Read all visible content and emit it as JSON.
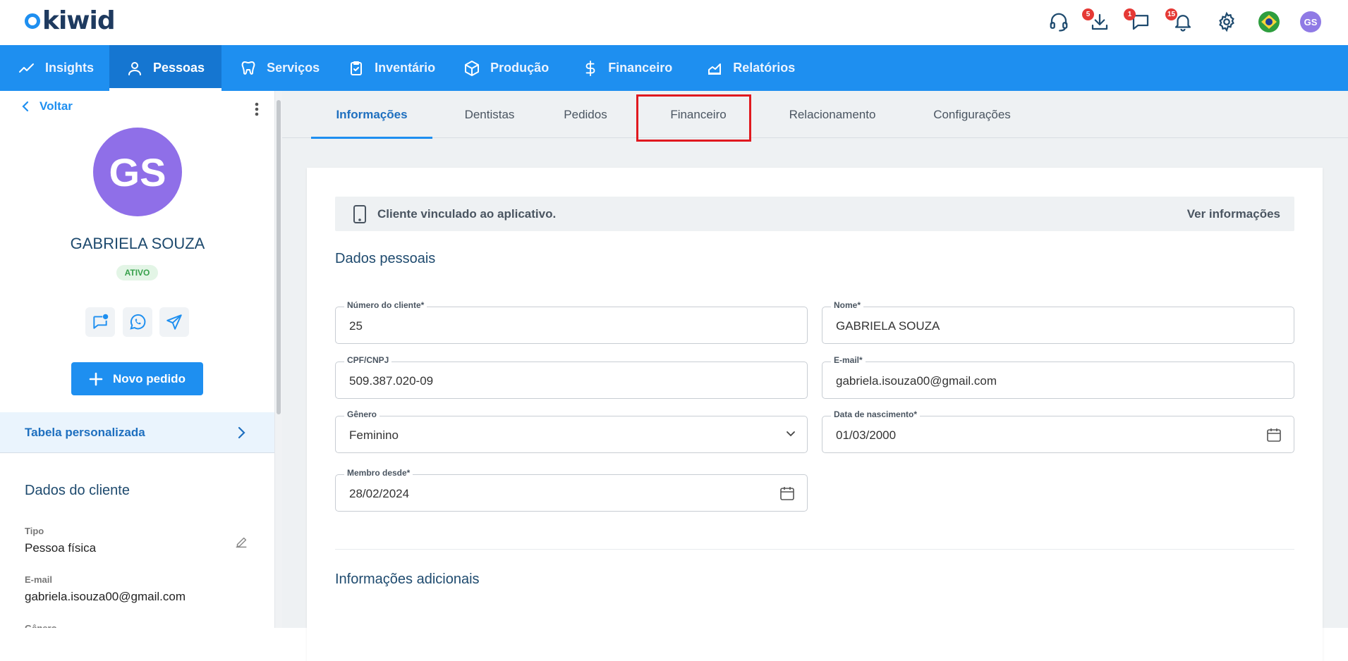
{
  "brand": {
    "name": "kiwid"
  },
  "topbar": {
    "badges": {
      "downloads": "5",
      "messages": "1",
      "notifications": "15"
    },
    "user_initials": "GS"
  },
  "nav": {
    "items": [
      {
        "label": "Insights"
      },
      {
        "label": "Pessoas"
      },
      {
        "label": "Serviços"
      },
      {
        "label": "Inventário"
      },
      {
        "label": "Produção"
      },
      {
        "label": "Financeiro"
      },
      {
        "label": "Relatórios"
      }
    ]
  },
  "left": {
    "back_label": "Voltar",
    "initials": "GS",
    "name": "GABRIELA SOUZA",
    "status": "ATIVO",
    "new_order_label": "Novo pedido",
    "table_label": "Tabela personalizada",
    "client_section_title": "Dados do cliente",
    "fields": [
      {
        "label": "Tipo",
        "value": "Pessoa física"
      },
      {
        "label": "E-mail",
        "value": "gabriela.isouza00@gmail.com"
      },
      {
        "label": "Gênero",
        "value": ""
      }
    ]
  },
  "tabs": [
    {
      "label": "Informações"
    },
    {
      "label": "Dentistas"
    },
    {
      "label": "Pedidos"
    },
    {
      "label": "Financeiro"
    },
    {
      "label": "Relacionamento"
    },
    {
      "label": "Configurações"
    }
  ],
  "banner": {
    "text": "Cliente vinculado ao aplicativo.",
    "link": "Ver informações"
  },
  "personal": {
    "title": "Dados pessoais",
    "fields": {
      "client_number": {
        "label": "Número do cliente*",
        "value": "25"
      },
      "name": {
        "label": "Nome*",
        "value": "GABRIELA SOUZA"
      },
      "cpf": {
        "label": "CPF/CNPJ",
        "value": "509.387.020-09"
      },
      "email": {
        "label": "E-mail*",
        "value": "gabriela.isouza00@gmail.com"
      },
      "gender": {
        "label": "Gênero",
        "value": "Feminino"
      },
      "birth": {
        "label": "Data de nascimento*",
        "value": "01/03/2000"
      },
      "member_since": {
        "label": "Membro desde*",
        "value": "28/02/2024"
      }
    }
  },
  "additional": {
    "title": "Informações adicionais"
  },
  "colors": {
    "primary": "#1e8ff0",
    "nav_active": "#1576d1",
    "highlight": "#e0191f",
    "avatar": "#8f6fe8"
  }
}
